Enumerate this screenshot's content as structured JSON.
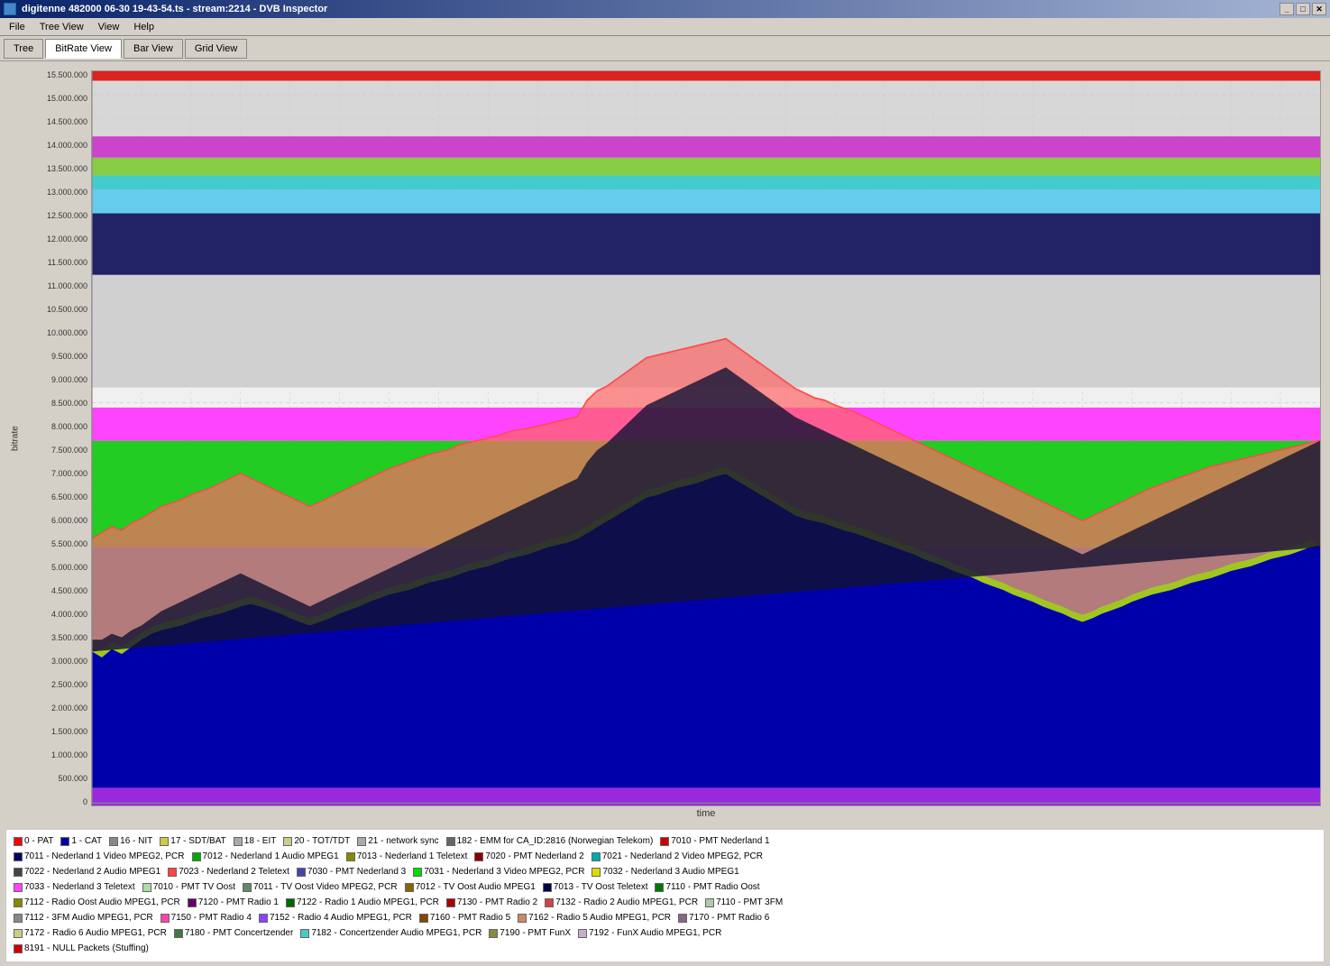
{
  "titlebar": {
    "title": "digitenne 482000 06-30 19-43-54.ts - stream:2214 - DVB Inspector",
    "icon": "dvb-inspector-icon",
    "controls": [
      "minimize",
      "maximize",
      "close"
    ]
  },
  "menubar": {
    "items": [
      "File",
      "Tree View",
      "View",
      "Help"
    ]
  },
  "toolbar": {
    "tabs": [
      {
        "label": "Tree",
        "active": false
      },
      {
        "label": "BitRate View",
        "active": true
      },
      {
        "label": "Bar View",
        "active": false
      },
      {
        "label": "Grid View",
        "active": false
      }
    ]
  },
  "chart": {
    "y_axis_label": "bitrate",
    "x_axis_label": "time",
    "y_labels": [
      "15.500.000",
      "15.000.000",
      "14.500.000",
      "14.000.000",
      "13.500.000",
      "13.000.000",
      "12.500.000",
      "12.000.000",
      "11.500.000",
      "11.000.000",
      "10.500.000",
      "10.000.000",
      "9.500.000",
      "9.000.000",
      "8.500.000",
      "8.000.000",
      "7.500.000",
      "7.000.000",
      "6.500.000",
      "6.000.000",
      "5.500.000",
      "5.000.000",
      "4.500.000",
      "4.000.000",
      "3.500.000",
      "3.000.000",
      "2.500.000",
      "2.000.000",
      "1.500.000",
      "1.000.000",
      "500.000",
      "0"
    ]
  },
  "legend": {
    "rows": [
      [
        {
          "color": "#ff0000",
          "label": "0 - PAT"
        },
        {
          "color": "#0000aa",
          "label": "1 - CAT"
        },
        {
          "color": "#888888",
          "label": "16 - NIT"
        },
        {
          "color": "#cccc00",
          "label": "17 - SDT/BAT"
        },
        {
          "color": "#aaaaaa",
          "label": "18 - EIT"
        },
        {
          "color": "#cccc88",
          "label": "20 - TOT/TDT"
        },
        {
          "color": "#888888",
          "label": "21 - network sync"
        },
        {
          "color": "#666666",
          "label": "182 - EMM for CA_ID:2816 (Norwegian Telekom)"
        },
        {
          "color": "#cc0000",
          "label": "7010 - PMT Nederland 1"
        }
      ],
      [
        {
          "color": "#000066",
          "label": "7011 - Nederland 1 Video MPEG2, PCR"
        },
        {
          "color": "#00aa00",
          "label": "7012 - Nederland 1 Audio MPEG1"
        },
        {
          "color": "#666600",
          "label": "7013 - Nederland 1 Teletext"
        },
        {
          "color": "#880000",
          "label": "7020 - PMT Nederland 2"
        },
        {
          "color": "#00aaaa",
          "label": "7021 - Nederland 2 Video MPEG2, PCR"
        }
      ],
      [
        {
          "color": "#333333",
          "label": "7022 - Nederland 2 Audio MPEG1"
        },
        {
          "color": "#ff4444",
          "label": "7023 - Nederland 2 Teletext"
        },
        {
          "color": "#4444aa",
          "label": "7030 - PMT Nederland 3"
        },
        {
          "color": "#00dd00",
          "label": "7031 - Nederland 3 Video MPEG2, PCR"
        },
        {
          "color": "#dddd00",
          "label": "7032 - Nederland 3 Audio MPEG1"
        }
      ],
      [
        {
          "color": "#ff44ff",
          "label": "7033 - Nederland 3 Teletext"
        },
        {
          "color": "#aaddaa",
          "label": "7010 - PMT TV Oost"
        },
        {
          "color": "#668866",
          "label": "7011 - TV Oost Video MPEG2, PCR"
        },
        {
          "color": "#886600",
          "label": "7012 - TV Oost Audio MPEG1"
        },
        {
          "color": "#000044",
          "label": "7013 - TV Oost Teletext"
        },
        {
          "color": "#007700",
          "label": "7110 - PMT Radio Oost"
        }
      ],
      [
        {
          "color": "#888800",
          "label": "7112 - Radio Oost Audio MPEG1, PCR"
        },
        {
          "color": "#660066",
          "label": "7120 - PMT Radio 1"
        },
        {
          "color": "#006600",
          "label": "7122 - Radio 1 Audio MPEG1, PCR"
        },
        {
          "color": "#aa0000",
          "label": "7130 - PMT Radio 2"
        },
        {
          "color": "#cc4444",
          "label": "7132 - Radio 2 Audio MPEG1, PCR"
        },
        {
          "color": "#aaccaa",
          "label": "7110 - PMT 3FM"
        }
      ],
      [
        {
          "color": "#888888",
          "label": "7112 - 3FM Audio MPEG1, PCR"
        },
        {
          "color": "#ff44aa",
          "label": "7150 - PMT Radio 4"
        },
        {
          "color": "#8844ff",
          "label": "7152 - Radio 4 Audio MPEG1, PCR"
        },
        {
          "color": "#884400",
          "label": "7160 - PMT Radio 5"
        },
        {
          "color": "#cc8866",
          "label": "7162 - Radio 5 Audio MPEG1, PCR"
        },
        {
          "color": "#886688",
          "label": "7170 - PMT Radio 6"
        }
      ],
      [
        {
          "color": "#cccc88",
          "label": "7172 - Radio 6 Audio MPEG1, PCR"
        },
        {
          "color": "#447744",
          "label": "7180 - PMT Concertzender"
        },
        {
          "color": "#44cccc",
          "label": "7182 - Concertzender Audio MPEG1, PCR"
        },
        {
          "color": "#888844",
          "label": "7190 - PMT FunX"
        },
        {
          "color": "#ccaacc",
          "label": "7192 - FunX Audio MPEG1, PCR"
        }
      ],
      [
        {
          "color": "#cc0000",
          "label": "8191 - NULL Packets (Stuffing)"
        }
      ]
    ]
  }
}
